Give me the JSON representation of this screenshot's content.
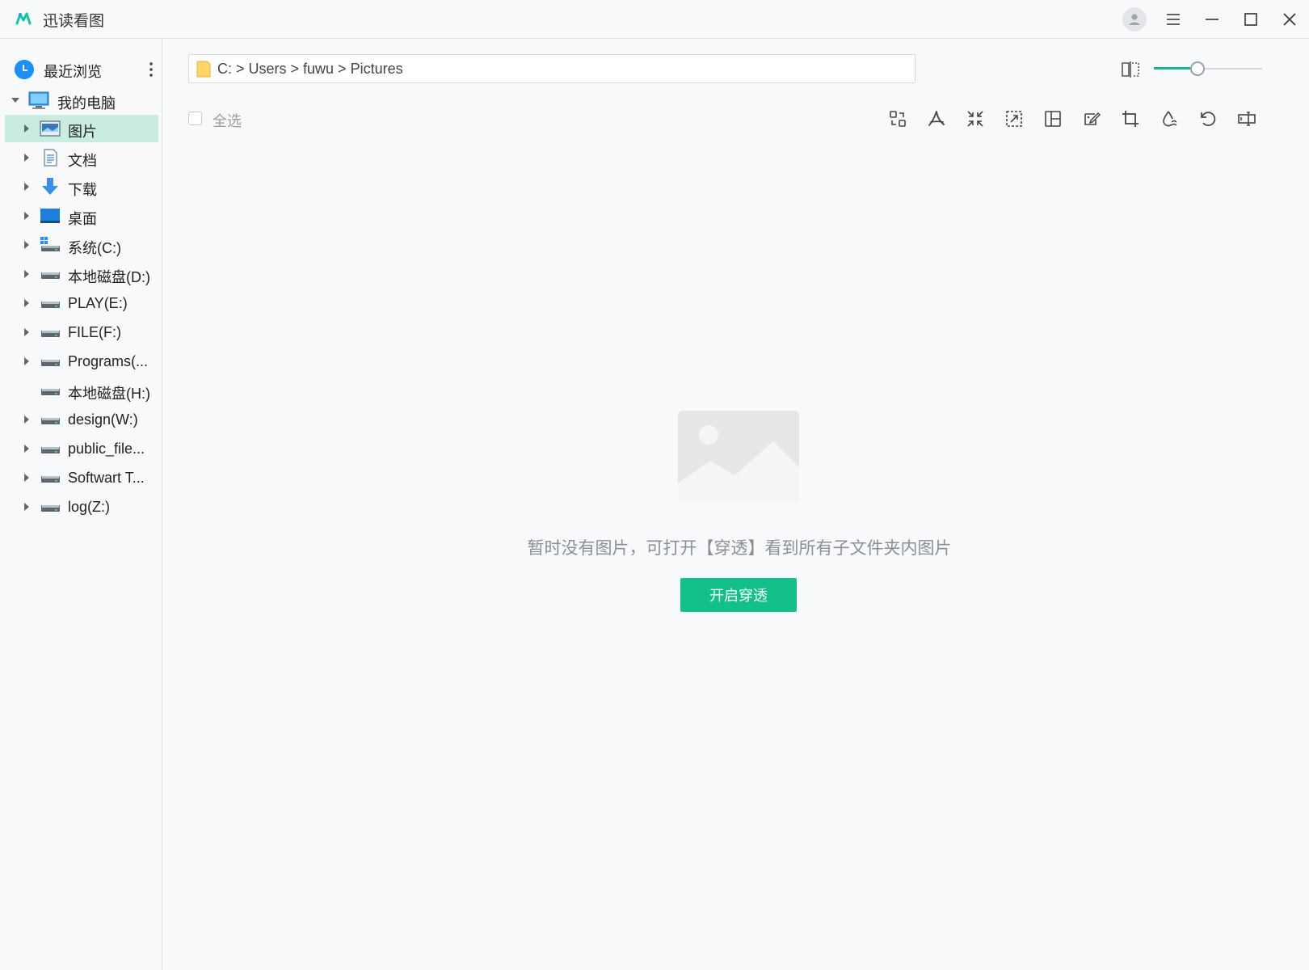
{
  "app": {
    "title": "迅读看图",
    "brand_color": "#13c08b"
  },
  "window_controls": [
    "user-icon",
    "menu-icon",
    "minimize-icon",
    "maximize-icon",
    "close-icon"
  ],
  "sidebar": {
    "recent_label": "最近浏览",
    "computer_label": "我的电脑",
    "items": [
      {
        "label": "图片",
        "icon": "pictures-folder-icon",
        "expandable": true,
        "selected": true
      },
      {
        "label": "文档",
        "icon": "documents-folder-icon",
        "expandable": true
      },
      {
        "label": "下载",
        "icon": "download-folder-icon",
        "expandable": true
      },
      {
        "label": "桌面",
        "icon": "desktop-folder-icon",
        "expandable": true
      },
      {
        "label": "系统(C:)",
        "icon": "system-drive-icon",
        "expandable": true
      },
      {
        "label": "本地磁盘(D:)",
        "icon": "drive-icon",
        "expandable": true
      },
      {
        "label": "PLAY(E:)",
        "icon": "drive-icon",
        "expandable": true
      },
      {
        "label": "FILE(F:)",
        "icon": "drive-icon",
        "expandable": true
      },
      {
        "label": "Programs(...",
        "icon": "drive-icon",
        "expandable": true
      },
      {
        "label": "本地磁盘(H:)",
        "icon": "drive-icon",
        "expandable": false
      },
      {
        "label": "design(W:)",
        "icon": "drive-icon",
        "expandable": true
      },
      {
        "label": "public_file...",
        "icon": "drive-icon",
        "expandable": true
      },
      {
        "label": "Softwart T...",
        "icon": "drive-icon",
        "expandable": true
      },
      {
        "label": "log(Z:)",
        "icon": "drive-icon",
        "expandable": true
      }
    ]
  },
  "path": {
    "text": "C: > Users > fuwu > Pictures"
  },
  "thumbnail_size": {
    "fraction": 0.4
  },
  "toolbar": {
    "select_all": "全选",
    "tools": [
      "convert-icon",
      "pdf-icon",
      "compress-icon",
      "resize-icon",
      "collage-icon",
      "edit-icon",
      "crop-icon",
      "watermark-icon",
      "rotate-icon",
      "rename-icon"
    ]
  },
  "empty_state": {
    "message": "暂时没有图片，可打开【穿透】看到所有子文件夹内图片",
    "button_label": "开启穿透"
  }
}
